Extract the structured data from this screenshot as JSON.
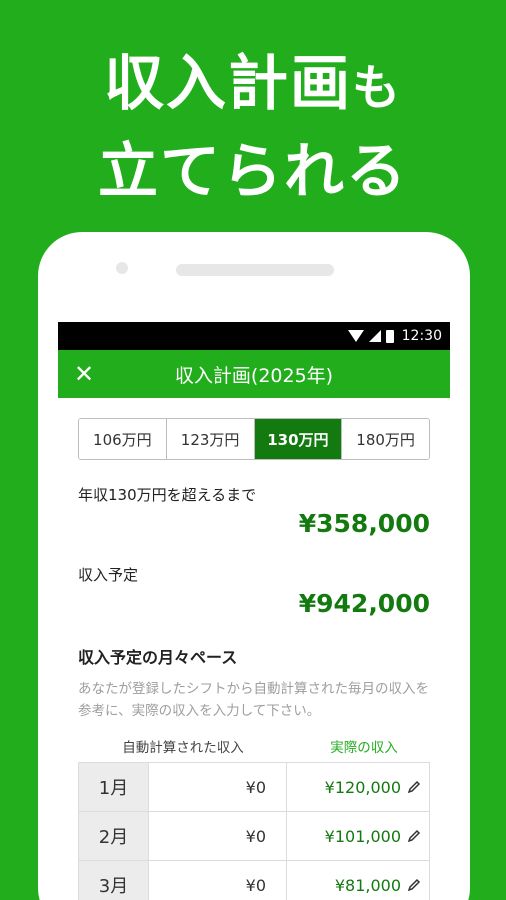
{
  "headline": {
    "line1": "収入計画",
    "line1_suffix": "も",
    "line2": "立てられる"
  },
  "status": {
    "time": "12:30"
  },
  "app_bar": {
    "close_glyph": "✕",
    "title": "収入計画(2025年)"
  },
  "tabs": [
    {
      "label": "106万円",
      "active": false
    },
    {
      "label": "123万円",
      "active": false
    },
    {
      "label": "130万円",
      "active": true
    },
    {
      "label": "180万円",
      "active": false
    }
  ],
  "until": {
    "label": "年収130万円を超えるまで",
    "amount": "¥358,000"
  },
  "planned": {
    "label": "収入予定",
    "amount": "¥942,000"
  },
  "pace": {
    "title": "収入予定の月々ペース",
    "description": "あなたが登録したシフトから自動計算された毎月の収入を参考に、実際の収入を入力して下さい。"
  },
  "table": {
    "col_auto": "自動計算された収入",
    "col_actual": "実際の収入",
    "rows": [
      {
        "month": "1月",
        "auto": "¥0",
        "actual": "¥120,000"
      },
      {
        "month": "2月",
        "auto": "¥0",
        "actual": "¥101,000"
      },
      {
        "month": "3月",
        "auto": "¥0",
        "actual": "¥81,000"
      }
    ]
  },
  "colors": {
    "brand_green": "#22ad1d",
    "dark_green": "#137a10"
  }
}
